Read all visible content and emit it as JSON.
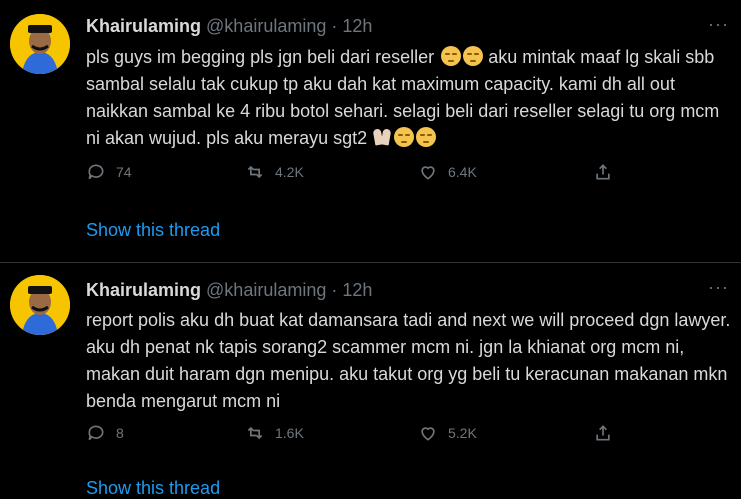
{
  "tweets": [
    {
      "name": "Khairulaming",
      "handle": "@khairulaming",
      "separator": "·",
      "time": "12h",
      "more": "···",
      "text_a": "pls guys im begging pls jgn beli dari reseller",
      "text_b": " aku mintak maaf lg skali sbb sambal selalu tak cukup tp aku dah kat maximum capacity. kami dh all out naikkan sambal ke 4 ribu botol sehari. selagi beli dari reseller selagi tu org mcm ni akan wujud. pls aku merayu sgt2",
      "replies": "74",
      "retweets": "4.2K",
      "likes": "6.4K",
      "show_thread": "Show this thread"
    },
    {
      "name": "Khairulaming",
      "handle": "@khairulaming",
      "separator": "·",
      "time": "12h",
      "more": "···",
      "text": "report polis aku dh buat kat damansara tadi and next we will proceed dgn lawyer. aku dh penat nk tapis sorang2 scammer mcm ni. jgn la khianat org mcm ni, makan duit haram dgn menipu. aku takut org yg beli tu keracunan makanan mkn benda mengarut mcm ni",
      "replies": "8",
      "retweets": "1.6K",
      "likes": "5.2K",
      "show_thread": "Show this thread"
    }
  ],
  "icons": [
    "avatar",
    "reply-icon",
    "retweet-icon",
    "like-icon",
    "share-icon",
    "pensive-face-icon",
    "folded-hands-icon"
  ],
  "colors": {
    "background": "#000000",
    "text": "#d9d9d9",
    "muted": "#6e767d",
    "link": "#1d9bf0",
    "avatar_bg": "#f6c500"
  }
}
